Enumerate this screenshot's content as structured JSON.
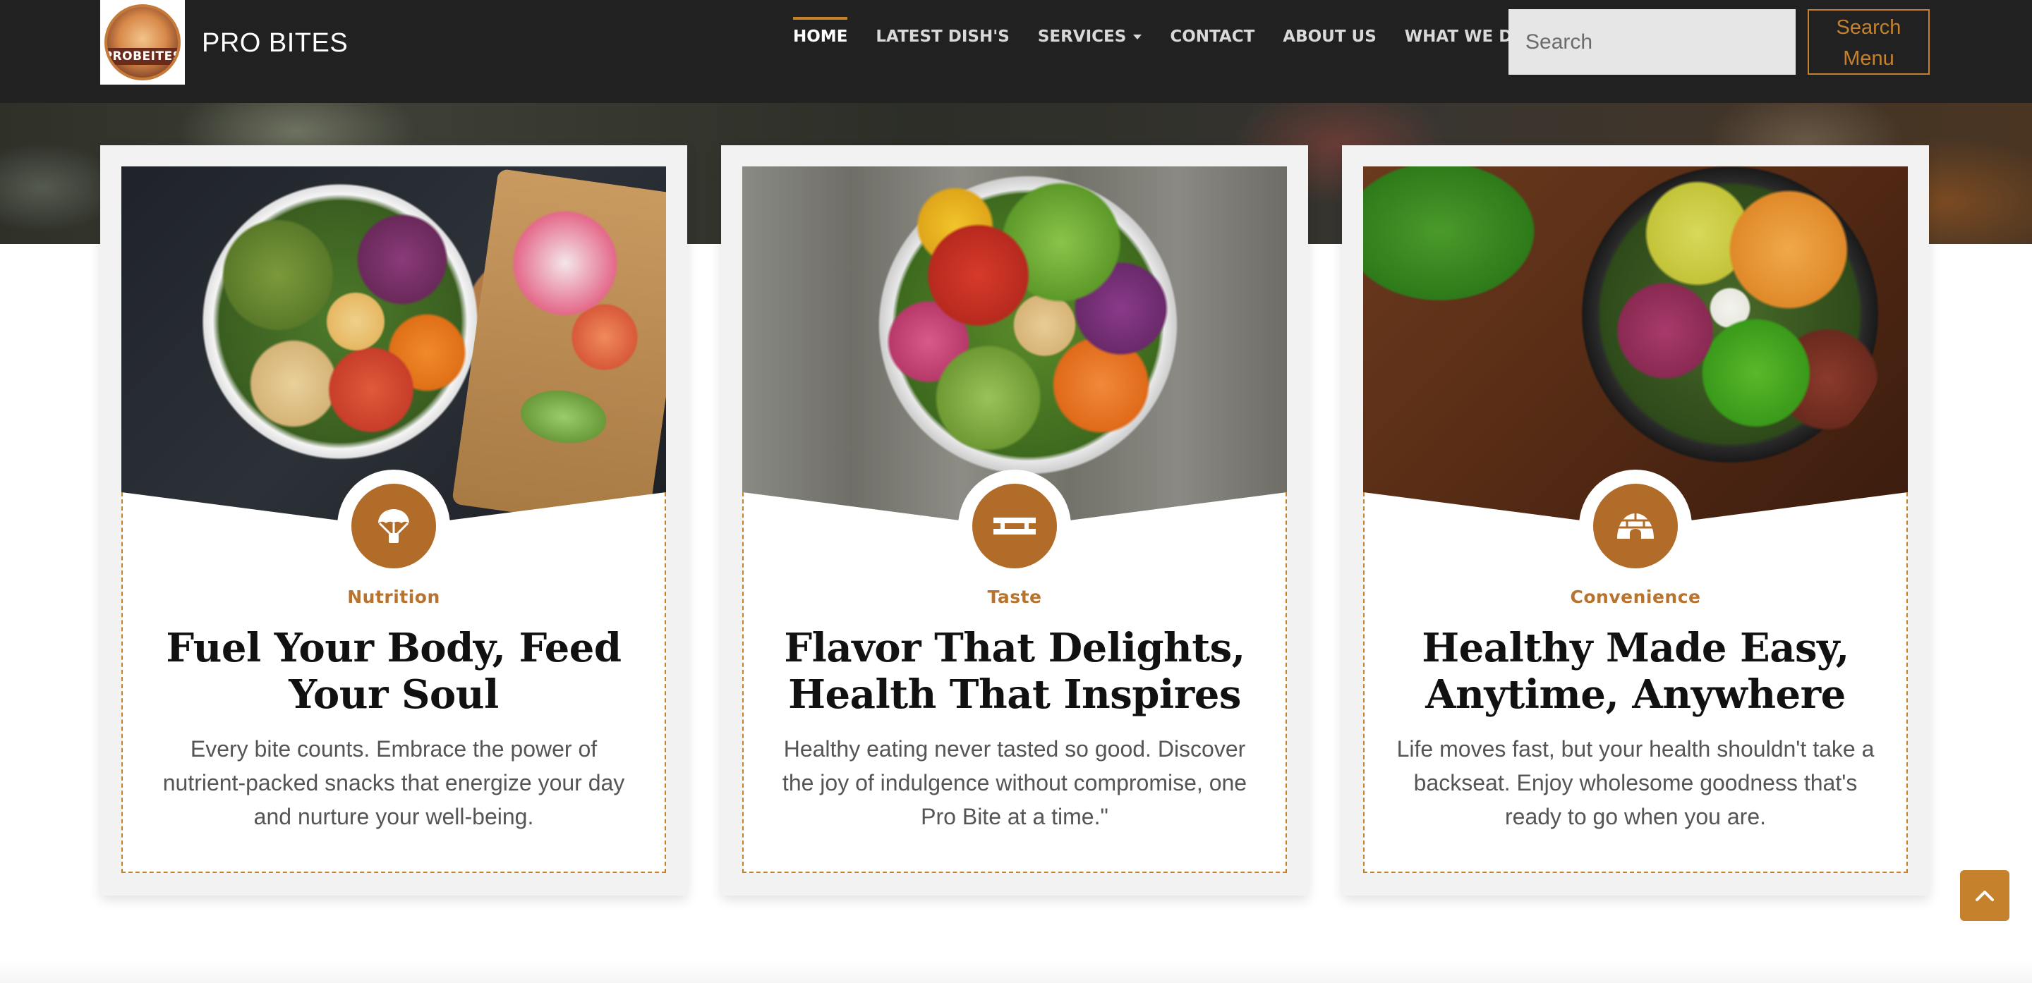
{
  "colors": {
    "accent": "#c5812c",
    "icon_bg": "#b16c2a",
    "navbar_bg": "#212121",
    "card_bg": "#f2f2f2"
  },
  "brand": {
    "logo_text": "PROBEITES",
    "name": "PRO BITES"
  },
  "nav": {
    "items": [
      {
        "label": "HOME",
        "active": true
      },
      {
        "label": "LATEST DISH'S",
        "active": false
      },
      {
        "label": "SERVICES",
        "active": false,
        "dropdown": true
      },
      {
        "label": "CONTACT",
        "active": false
      },
      {
        "label": "ABOUT US",
        "active": false
      },
      {
        "label": "WHAT WE DO",
        "active": false
      }
    ],
    "search_placeholder": "Search",
    "search_button": "Search Menu"
  },
  "cards": [
    {
      "icon": "parachute-icon",
      "tag": "Nutrition",
      "title": "Fuel Your Body, Feed Your Soul",
      "description": "Every bite counts. Embrace the power of nutrient-packed snacks that energize your day and nurture your well-being."
    },
    {
      "icon": "bench-icon",
      "tag": "Taste",
      "title": "Flavor That Delights, Health That Inspires",
      "description": "Healthy eating never tasted so good. Discover the joy of indulgence without compromise, one Pro Bite at a time.\""
    },
    {
      "icon": "igloo-icon",
      "tag": "Convenience",
      "title": "Healthy Made Easy, Anytime, Anywhere",
      "description": "Life moves fast, but your health shouldn't take a backseat. Enjoy wholesome goodness that's ready to go when you are."
    }
  ],
  "scroll_top": {
    "icon": "chevron-up-icon"
  }
}
